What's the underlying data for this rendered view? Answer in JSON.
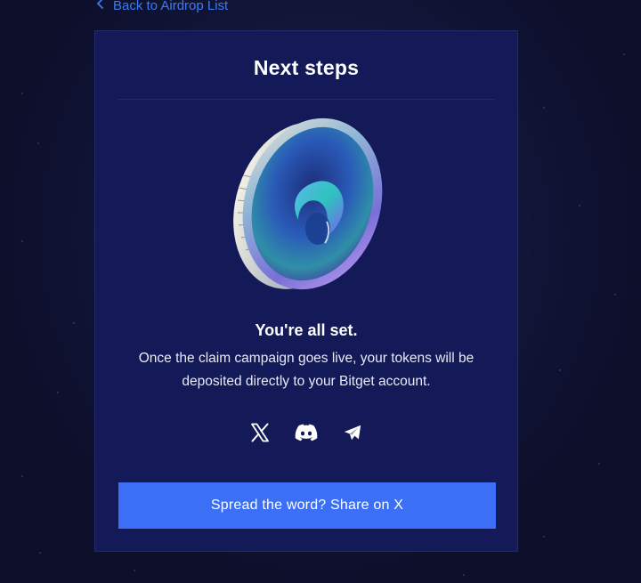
{
  "nav": {
    "back_label": "Back to Airdrop List",
    "back_icon": "chevron-left-icon"
  },
  "card": {
    "title": "Next steps",
    "illustration": "coin-icon",
    "status_heading": "You're all set.",
    "status_body": "Once the claim campaign goes live, your tokens will be deposited directly to your Bitget account.",
    "socials": [
      {
        "name": "x-icon"
      },
      {
        "name": "discord-icon"
      },
      {
        "name": "telegram-icon"
      }
    ],
    "share_button_label": "Spread the word? Share on X"
  },
  "colors": {
    "page_bg": "#0d0f2b",
    "card_bg": "#131a57",
    "accent": "#3b6ff5",
    "link": "#3b7bf6"
  }
}
